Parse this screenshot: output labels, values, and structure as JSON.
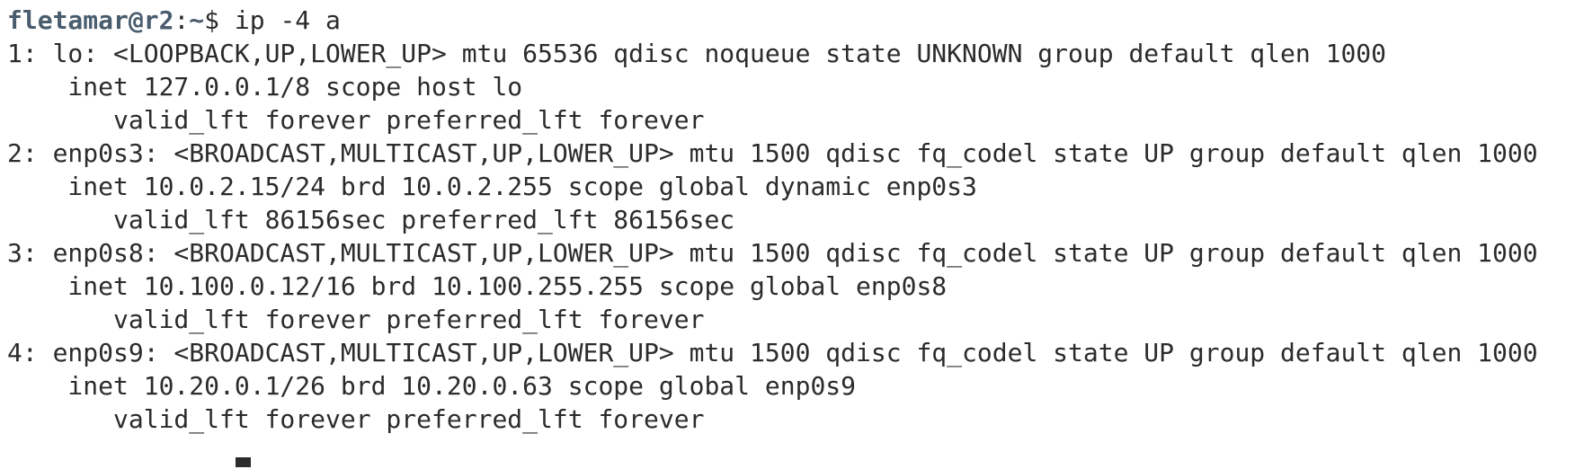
{
  "prompt": {
    "user_host": "fletamar@r2",
    "separator": ":",
    "path": "~",
    "symbol": "$ ",
    "command": "ip -4 a"
  },
  "output": [
    "1: lo: <LOOPBACK,UP,LOWER_UP> mtu 65536 qdisc noqueue state UNKNOWN group default qlen 1000",
    "    inet 127.0.0.1/8 scope host lo",
    "       valid_lft forever preferred_lft forever",
    "2: enp0s3: <BROADCAST,MULTICAST,UP,LOWER_UP> mtu 1500 qdisc fq_codel state UP group default qlen 1000",
    "    inet 10.0.2.15/24 brd 10.0.2.255 scope global dynamic enp0s3",
    "       valid_lft 86156sec preferred_lft 86156sec",
    "3: enp0s8: <BROADCAST,MULTICAST,UP,LOWER_UP> mtu 1500 qdisc fq_codel state UP group default qlen 1000",
    "    inet 10.100.0.12/16 brd 10.100.255.255 scope global enp0s8",
    "       valid_lft forever preferred_lft forever",
    "4: enp0s9: <BROADCAST,MULTICAST,UP,LOWER_UP> mtu 1500 qdisc fq_codel state UP group default qlen 1000",
    "    inet 10.20.0.1/26 brd 10.20.0.63 scope global enp0s9",
    "       valid_lft forever preferred_lft forever"
  ],
  "colors": {
    "background": "#ffffff",
    "text": "#2b2b2b",
    "prompt": "#4a5d6e"
  }
}
